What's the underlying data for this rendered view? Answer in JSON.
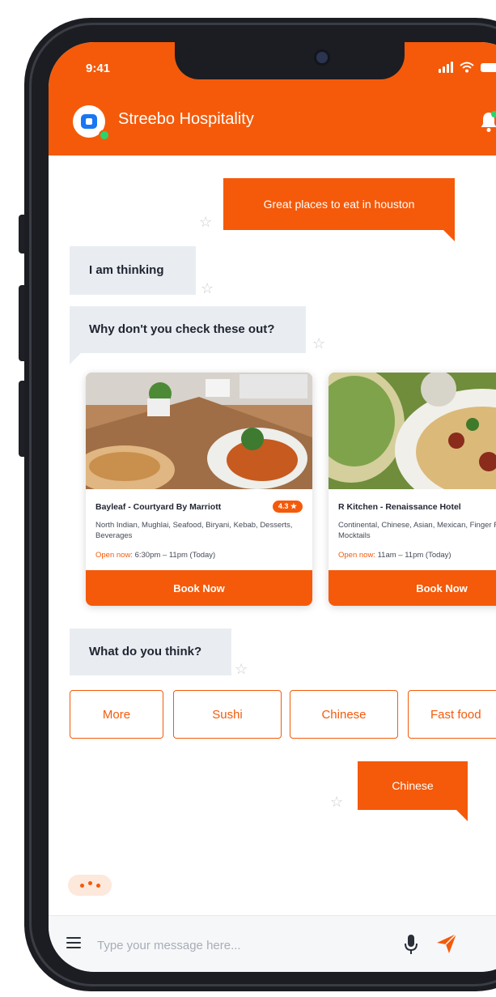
{
  "status_bar": {
    "time": "9:41"
  },
  "header": {
    "title": "Streebo Hospitality"
  },
  "messages": {
    "user_query": "Great places to eat in houston",
    "bot_thinking": "I am thinking",
    "bot_suggest": "Why don't you check these out?",
    "bot_question": "What do you think?",
    "user_choice": "Chinese"
  },
  "cards": [
    {
      "name": "Bayleaf - Courtyard By Marriott",
      "rating": "4.3 ★",
      "cuisine": "North Indian, Mughlai, Seafood, Biryani, Kebab, Desserts, Beverages",
      "open_label": "Open now:",
      "hours": "6:30pm – 11pm (Today)",
      "button": "Book Now"
    },
    {
      "name": "R Kitchen - Renaissance Hotel",
      "cuisine": "Continental, Chinese, Asian, Mexican, Finger Foods, Mocktails",
      "open_label": "Open now:",
      "hours": "11am – 11pm (Today)",
      "button": "Book Now"
    }
  ],
  "quick_replies": [
    "More",
    "Sushi",
    "Chinese",
    "Fast food"
  ],
  "composer": {
    "placeholder": "Type your message here..."
  },
  "colors": {
    "brand": "#f45a0a",
    "bubble_in": "#e9edf2",
    "online": "#2bd46b"
  }
}
